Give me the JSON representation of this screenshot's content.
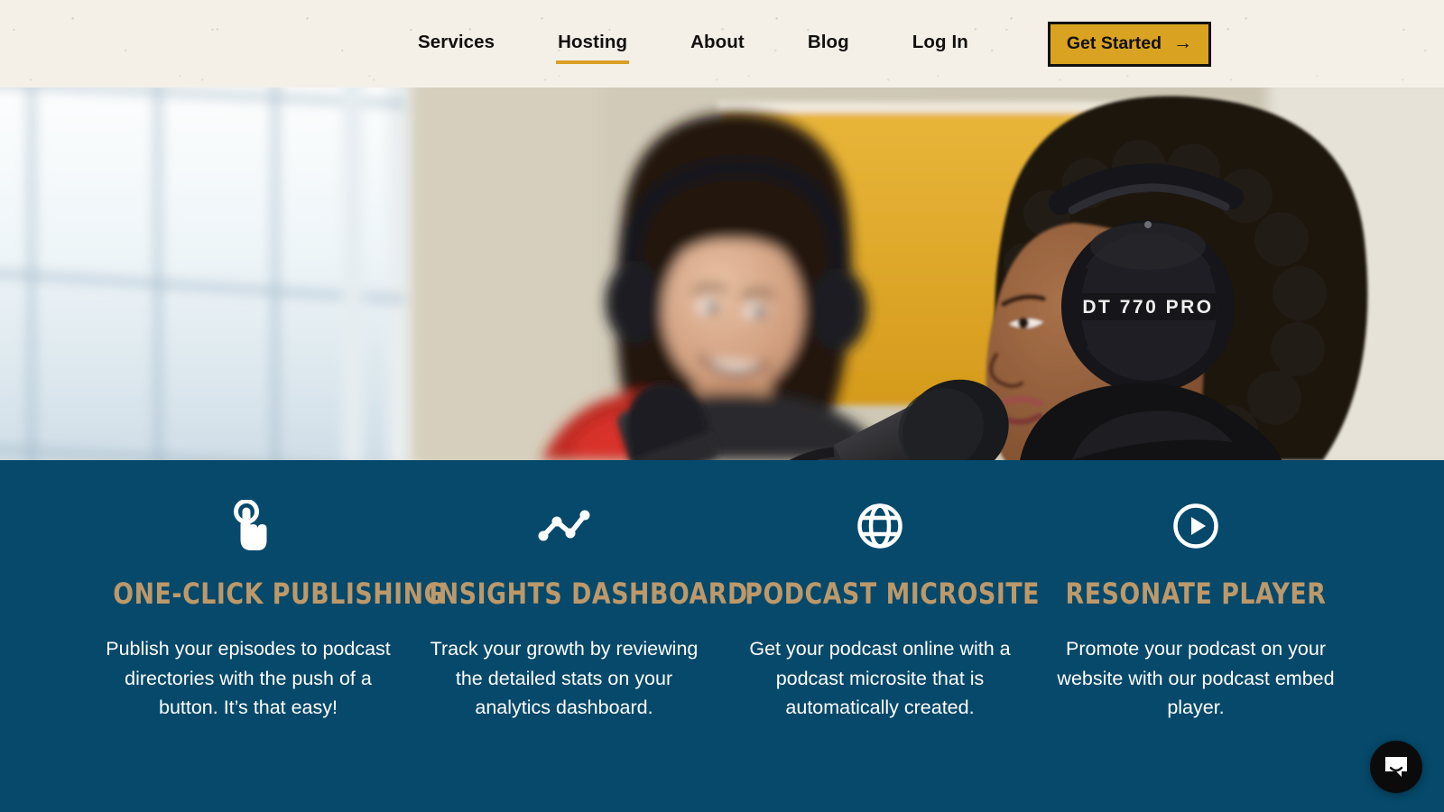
{
  "header": {
    "nav_items": [
      {
        "label": "Services",
        "active": false,
        "name": "nav-link-services"
      },
      {
        "label": "Hosting",
        "active": true,
        "name": "nav-link-hosting"
      },
      {
        "label": "About",
        "active": false,
        "name": "nav-link-about"
      },
      {
        "label": "Blog",
        "active": false,
        "name": "nav-link-blog"
      },
      {
        "label": "Log In",
        "active": false,
        "name": "nav-link-login"
      }
    ],
    "cta": {
      "label": "Get Started",
      "arrow": "→"
    },
    "background_color": "#f4f0e8",
    "accent_color": "#d9a321",
    "text_color": "#12100e"
  },
  "hero": {
    "alt": "Two podcasters wearing over-ear headphones speaking into studio microphones in a bright room",
    "headphone_label": "DT 770 PRO",
    "colors": {
      "window": "#dfe9f0",
      "wall": "#cfc8b6",
      "board": "#dfa827",
      "mic": "#1b1b1d",
      "jacket_red": "#c02a22"
    }
  },
  "features": {
    "background_color": "#06496b",
    "title_color": "#bd9869",
    "body_color": "#ffffff",
    "cards": [
      {
        "icon": "tap-hand-icon",
        "title": "One-Click Publishing",
        "body": "Publish your episodes to podcast directories with the push of a button. It’s that easy!"
      },
      {
        "icon": "line-chart-icon",
        "title": "Insights Dashboard",
        "body": "Track your growth by reviewing the detailed stats on your analytics dashboard."
      },
      {
        "icon": "globe-icon",
        "title": "Podcast Microsite",
        "body": "Get your podcast online with a podcast microsite that is automatically created."
      },
      {
        "icon": "play-circle-icon",
        "title": "Resonate Player",
        "body": "Promote your podcast on your website with our podcast embed player."
      }
    ]
  },
  "chat_widget": {
    "icon": "chat-bubble-icon",
    "label": "Open chat",
    "background_color": "#0b0b0b"
  }
}
